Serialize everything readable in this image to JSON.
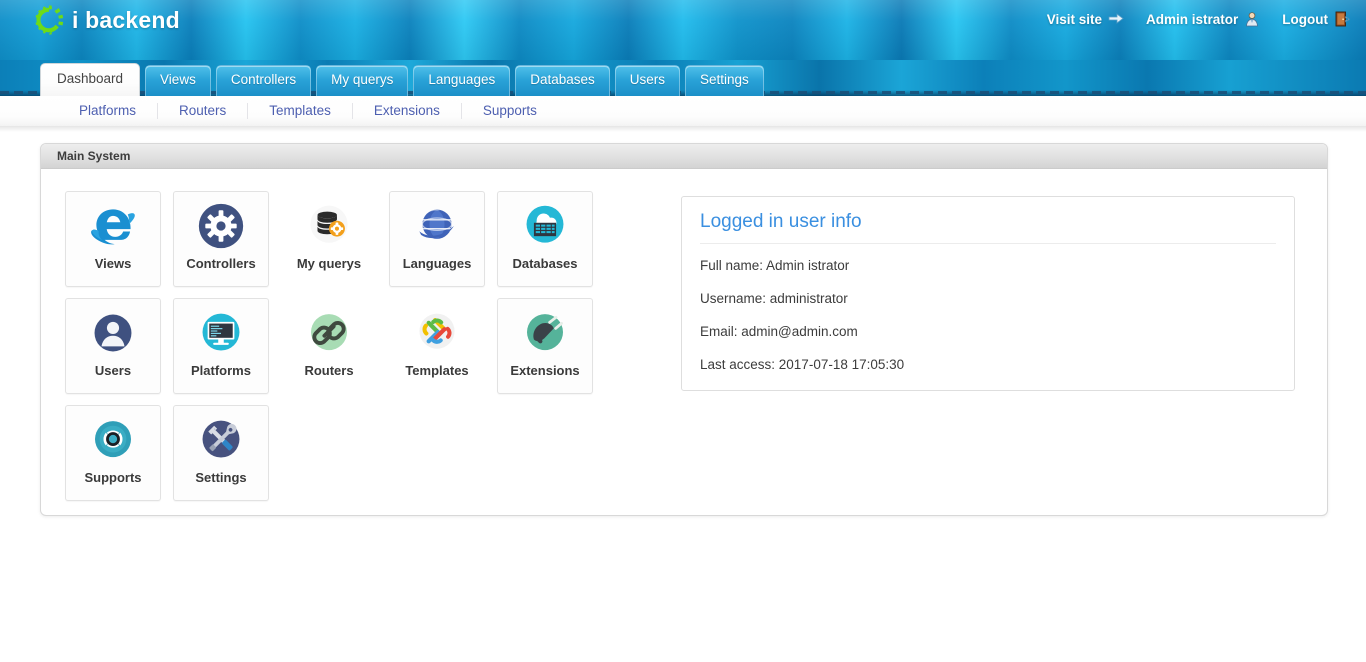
{
  "brand": {
    "name": "i backend",
    "logo_icon": "green-gear-icon",
    "logo_color": "#6ddb18"
  },
  "header": {
    "actions": [
      {
        "label": "Visit site",
        "icon": "arrow-right-icon"
      },
      {
        "label": "Admin istrator",
        "icon": "user-avatar-icon"
      },
      {
        "label": "Logout",
        "icon": "exit-door-icon"
      }
    ]
  },
  "nav": {
    "tabs": [
      {
        "label": "Dashboard",
        "active": true
      },
      {
        "label": "Views",
        "active": false
      },
      {
        "label": "Controllers",
        "active": false
      },
      {
        "label": "My querys",
        "active": false
      },
      {
        "label": "Languages",
        "active": false
      },
      {
        "label": "Databases",
        "active": false
      },
      {
        "label": "Users",
        "active": false
      },
      {
        "label": "Settings",
        "active": false
      }
    ],
    "subnav": [
      {
        "label": "Platforms"
      },
      {
        "label": "Routers"
      },
      {
        "label": "Templates"
      },
      {
        "label": "Extensions"
      },
      {
        "label": "Supports"
      }
    ]
  },
  "panel": {
    "title": "Main System",
    "tiles": [
      {
        "label": "Views",
        "icon": "internet-explorer-e-icon",
        "bordered": true
      },
      {
        "label": "Controllers",
        "icon": "gear-circle-icon",
        "bordered": true
      },
      {
        "label": "My querys",
        "icon": "database-stack-gear-icon",
        "bordered": false
      },
      {
        "label": "Languages",
        "icon": "globe-icon",
        "bordered": true
      },
      {
        "label": "Databases",
        "icon": "cloud-server-icon",
        "bordered": true
      },
      {
        "label": "Users",
        "icon": "person-circle-icon",
        "bordered": true
      },
      {
        "label": "Platforms",
        "icon": "monitor-icon",
        "bordered": true
      },
      {
        "label": "Routers",
        "icon": "chain-link-icon",
        "bordered": false
      },
      {
        "label": "Templates",
        "icon": "joomla-logo-icon",
        "bordered": false
      },
      {
        "label": "Extensions",
        "icon": "power-plug-icon",
        "bordered": true
      },
      {
        "label": "Supports",
        "icon": "lifebuoy-icon",
        "bordered": true
      },
      {
        "label": "Settings",
        "icon": "wrench-screwdriver-icon",
        "bordered": true
      }
    ]
  },
  "user_info": {
    "title": "Logged in user info",
    "rows": [
      "Full name: Admin istrator",
      "Username: administrator",
      "Email: admin@admin.com",
      "Last access: 2017-07-18 17:05:30"
    ]
  },
  "colors": {
    "header_blue": "#00a7e0",
    "tab_blue": "#2aa3d8",
    "subnav_link": "#4d5fb0",
    "panel_title_blue": "#3a8fe0",
    "logo_green": "#6ddb18"
  }
}
